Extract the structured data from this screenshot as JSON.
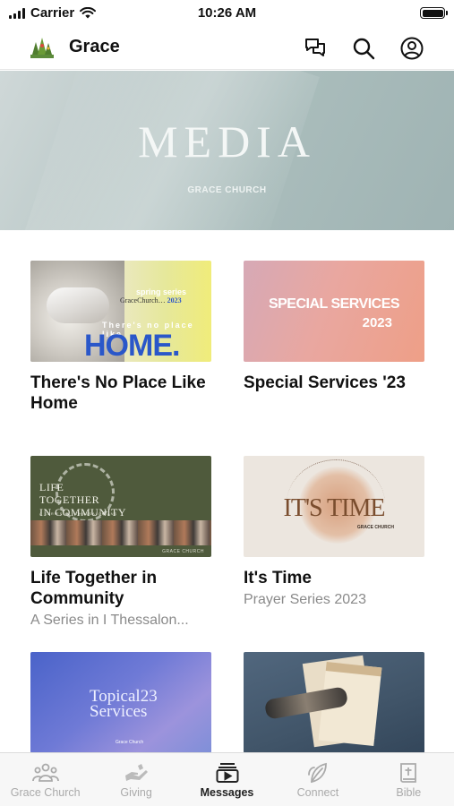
{
  "status_bar": {
    "carrier": "Carrier",
    "time": "10:26 AM"
  },
  "header": {
    "app_name": "Grace",
    "icons": [
      "chat-icon",
      "search-icon",
      "account-icon"
    ]
  },
  "hero": {
    "title": "MEDIA",
    "subtitle": "GRACE CHURCH"
  },
  "series": [
    {
      "title": "There's No Place Like Home",
      "subtitle": "",
      "thumb": {
        "series": "spring series",
        "church": "GraceChurch",
        "year": "2023",
        "line": "There's no place like",
        "big": "HOME."
      }
    },
    {
      "title": "Special Services '23",
      "subtitle": "",
      "thumb": {
        "line1": "SPECIAL SERVICES",
        "line2": "2023"
      }
    },
    {
      "title": "Life Together in Community",
      "subtitle": "A Series in I Thessalon...",
      "thumb": {
        "line1": "LIFE",
        "line2": "TOGETHER",
        "line3": "IN COMMUNITY",
        "tag": "A SERIES IN I THESSALONIANS",
        "footer": "GRACE CHURCH"
      }
    },
    {
      "title": "It's Time",
      "subtitle": "Prayer Series 2023",
      "thumb": {
        "big": "IT'S TIME",
        "footer": "GRACE CHURCH"
      }
    },
    {
      "title": "",
      "subtitle": "",
      "thumb": {
        "line1": "Topical23",
        "line2": "Services",
        "footer": "Grace Church"
      }
    },
    {
      "title": "",
      "subtitle": "",
      "thumb": {}
    }
  ],
  "tab_bar": {
    "tabs": [
      {
        "label": "Grace Church",
        "icon": "people-icon",
        "active": false
      },
      {
        "label": "Giving",
        "icon": "giving-hand-icon",
        "active": false
      },
      {
        "label": "Messages",
        "icon": "play-media-icon",
        "active": true
      },
      {
        "label": "Connect",
        "icon": "leaf-icon",
        "active": false
      },
      {
        "label": "Bible",
        "icon": "bible-icon",
        "active": false
      }
    ]
  },
  "colors": {
    "accent_blue": "#2a57c9",
    "tab_inactive": "#aaaaaa",
    "tab_active": "#222222"
  }
}
